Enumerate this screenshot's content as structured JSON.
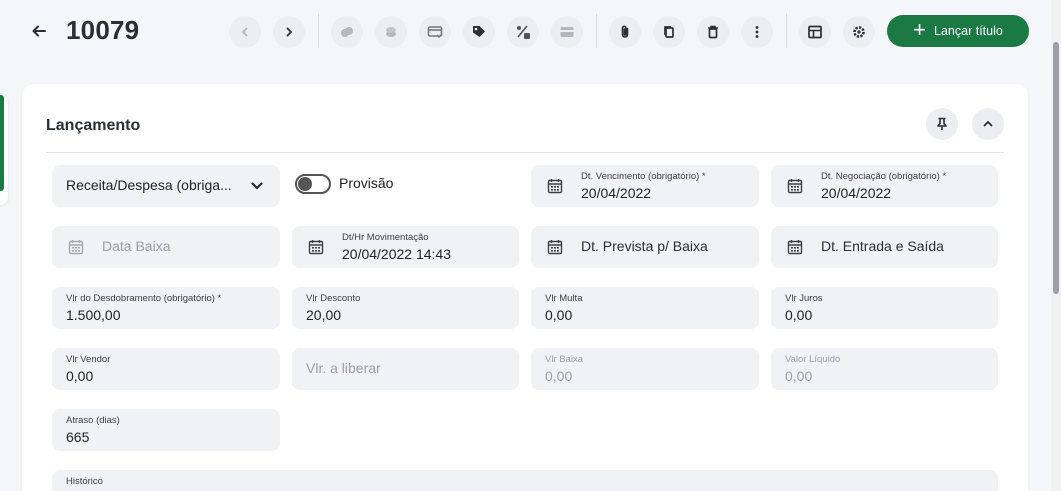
{
  "header": {
    "title": "10079",
    "primary_label": "Lançar título"
  },
  "toolbar_icons": [
    "chevron-left-icon",
    "chevron-right-icon",
    "coins-stack-icon",
    "coins-icon",
    "card-transfer-icon",
    "tag-icon",
    "percent-icon",
    "credit-card-icon",
    "paperclip-icon",
    "copy-icon",
    "trash-icon",
    "more-vertical-icon",
    "layout-icon",
    "settings-icon"
  ],
  "section": {
    "title": "Lançamento"
  },
  "form": {
    "tipo": {
      "value": "Receita/Despesa (obriga..."
    },
    "provisao": {
      "label": "Provisão",
      "checked": false
    },
    "dt_vencimento": {
      "label": "Dt. Vencimento (obrigatório) *",
      "value": "20/04/2022"
    },
    "dt_negociacao": {
      "label": "Dt. Negociação (obrigatório) *",
      "value": "20/04/2022"
    },
    "data_baixa": {
      "placeholder": "Data Baixa"
    },
    "dt_hr_mov": {
      "label": "Dt/Hr Movimentação",
      "value": "20/04/2022 14:43"
    },
    "dt_prevista": {
      "placeholder": "Dt. Prevista p/ Baixa"
    },
    "dt_entrada": {
      "placeholder": "Dt. Entrada e Saída"
    },
    "vlr_desdobramento": {
      "label": "Vlr do Desdobramento (obrigatório) *",
      "value": "1.500,00"
    },
    "vlr_desconto": {
      "label": "Vlr Desconto",
      "value": "20,00"
    },
    "vlr_multa": {
      "label": "Vlr Multa",
      "value": "0,00"
    },
    "vlr_juros": {
      "label": "Vlr Juros",
      "value": "0,00"
    },
    "vlr_vendor": {
      "label": "Vlr Vendor",
      "value": "0,00"
    },
    "vlr_liberar": {
      "placeholder": "Vlr. a liberar"
    },
    "vlr_baixa": {
      "label": "Vlr Baixa",
      "value": "0,00"
    },
    "valor_liquido": {
      "label": "Valor Líquido",
      "value": "0,00"
    },
    "atraso": {
      "label": "Atraso (dias)",
      "value": "665"
    },
    "historico": {
      "label": "Histórico"
    }
  },
  "colors": {
    "primary": "#1b7a44",
    "field_bg": "#f0f2f5"
  }
}
